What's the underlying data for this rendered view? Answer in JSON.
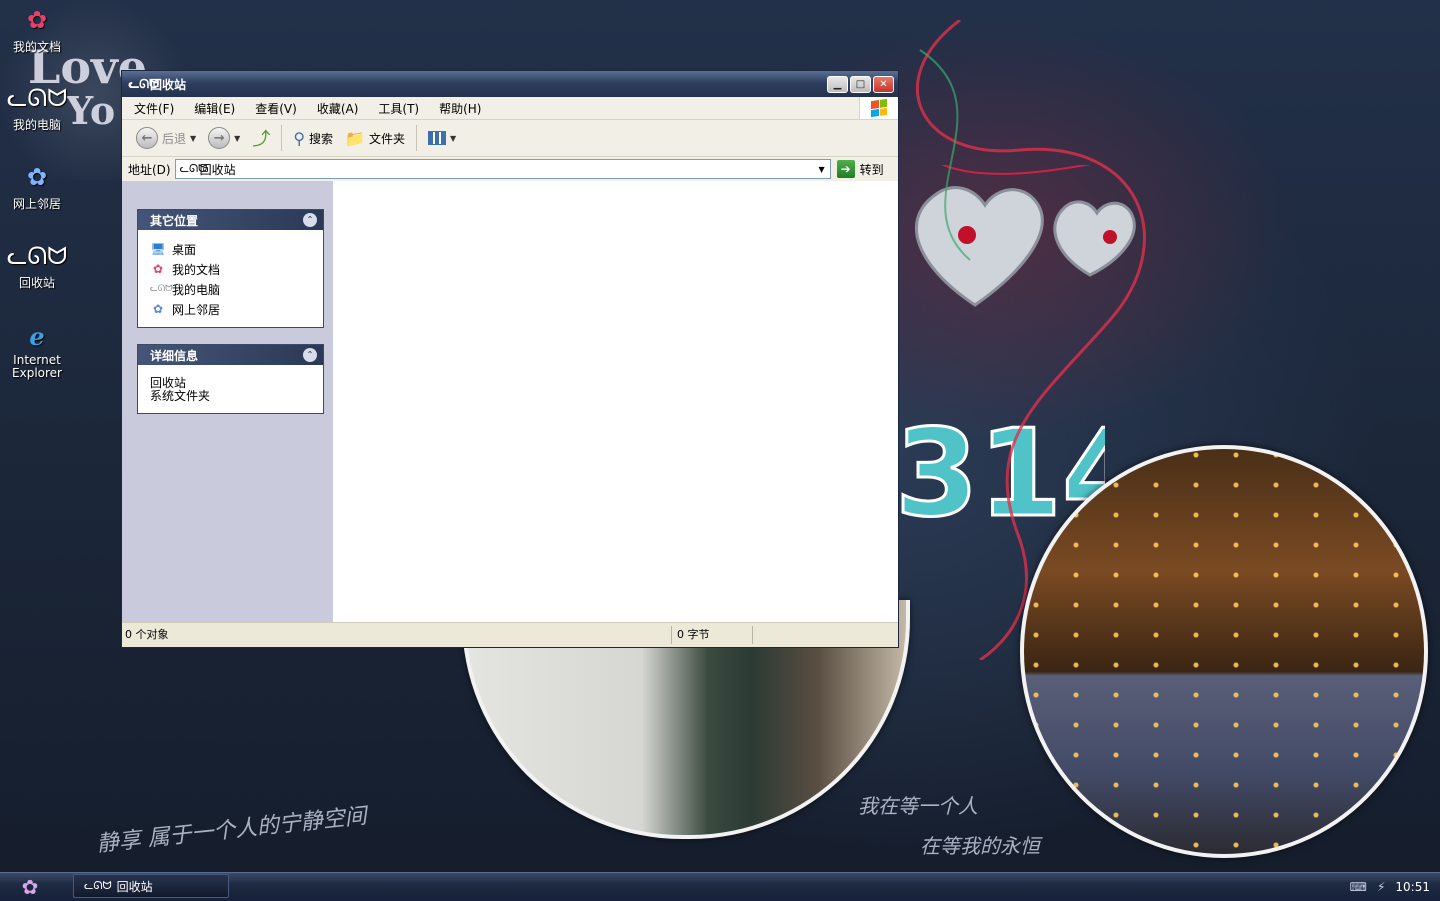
{
  "desktop": {
    "icons": [
      {
        "label": "我的文档",
        "icon": "flower-icon"
      },
      {
        "label": "我的电脑",
        "icon": "hello-kitty-icon"
      },
      {
        "label": "网上邻居",
        "icon": "network-icon"
      },
      {
        "label": "回收站",
        "icon": "hello-kitty-icon"
      },
      {
        "label": "Internet Explorer",
        "icon": "ie-icon"
      }
    ],
    "wallpaper": {
      "love": "Love",
      "you": "Yo",
      "num": "314",
      "text1": "静享 属于一个人的宁静空间",
      "text2": "我在等一个人",
      "text3": "在等我的永恒"
    }
  },
  "window": {
    "title": "回收站",
    "menu": [
      "文件(F)",
      "编辑(E)",
      "查看(V)",
      "收藏(A)",
      "工具(T)",
      "帮助(H)"
    ],
    "toolbar": {
      "back": "后退",
      "search": "搜索",
      "folders": "文件夹"
    },
    "address": {
      "label": "地址(D)",
      "value": "回收站",
      "go": "转到"
    },
    "panels": {
      "other_places": {
        "title": "其它位置",
        "items": [
          "桌面",
          "我的文档",
          "我的电脑",
          "网上邻居"
        ]
      },
      "details": {
        "title": "详细信息",
        "name": "回收站",
        "type": "系统文件夹"
      }
    },
    "status": {
      "objects": "0 个对象",
      "size": "0 字节"
    }
  },
  "taskbar": {
    "task_label": "回收站",
    "clock": "10:51"
  },
  "colors": {
    "title_bar": "#2e3f60",
    "task_pane": "#c9cbdc",
    "desktop": "#1b2638"
  }
}
